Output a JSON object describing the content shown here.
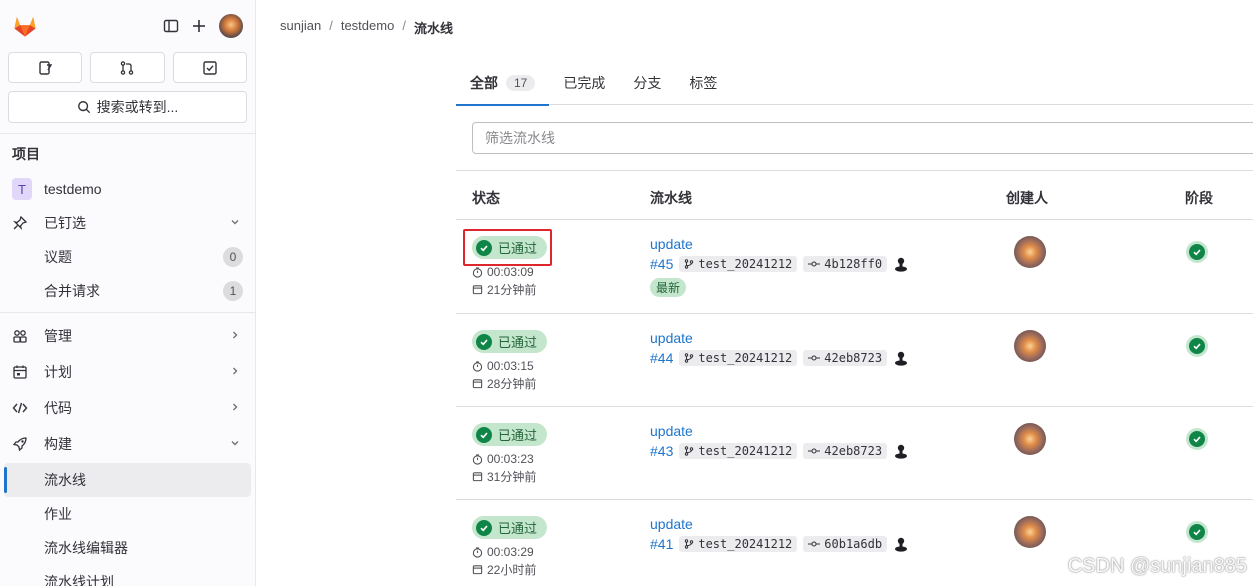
{
  "sidebar": {
    "search_label": "搜索或转到...",
    "section_title": "项目",
    "project": {
      "initial": "T",
      "name": "testdemo"
    },
    "pinned": {
      "label": "已钉选",
      "items": [
        {
          "label": "议题",
          "count": "0"
        },
        {
          "label": "合并请求",
          "count": "1"
        }
      ]
    },
    "nav": [
      {
        "label": "管理"
      },
      {
        "label": "计划"
      },
      {
        "label": "代码"
      },
      {
        "label": "构建"
      }
    ],
    "build_sub": [
      {
        "label": "流水线"
      },
      {
        "label": "作业"
      },
      {
        "label": "流水线编辑器"
      },
      {
        "label": "流水线计划"
      }
    ]
  },
  "breadcrumb": {
    "items": [
      "sunjian",
      "testdemo",
      "流水线"
    ]
  },
  "tabs": [
    {
      "label": "全部",
      "count": "17"
    },
    {
      "label": "已完成"
    },
    {
      "label": "分支"
    },
    {
      "label": "标签"
    }
  ],
  "filter": {
    "placeholder": "筛选流水线"
  },
  "table": {
    "headers": {
      "status": "状态",
      "pipeline": "流水线",
      "creator": "创建人",
      "stage": "阶段"
    },
    "rows": [
      {
        "status": "已通过",
        "duration": "00:03:09",
        "ago": "21分钟前",
        "title": "update",
        "id": "#45",
        "branch": "test_20241212",
        "commit": "4b128ff0",
        "latest": "最新"
      },
      {
        "status": "已通过",
        "duration": "00:03:15",
        "ago": "28分钟前",
        "title": "update",
        "id": "#44",
        "branch": "test_20241212",
        "commit": "42eb8723"
      },
      {
        "status": "已通过",
        "duration": "00:03:23",
        "ago": "31分钟前",
        "title": "update",
        "id": "#43",
        "branch": "test_20241212",
        "commit": "42eb8723"
      },
      {
        "status": "已通过",
        "duration": "00:03:29",
        "ago": "22小时前",
        "title": "update",
        "id": "#41",
        "branch": "test_20241212",
        "commit": "60b1a6db"
      }
    ]
  },
  "watermark": "CSDN @sunjian885",
  "colors": {
    "accent": "#1f75cb",
    "success": "#108548",
    "success_bg": "#c3e6cd",
    "highlight": "#e0262d"
  }
}
